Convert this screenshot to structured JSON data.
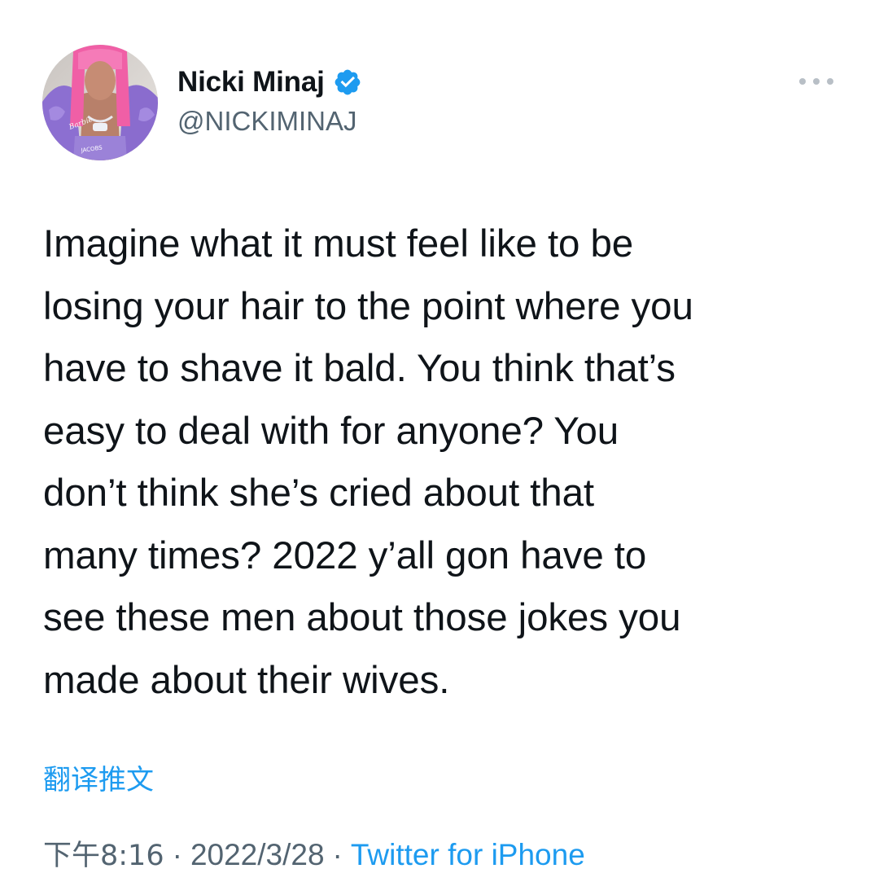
{
  "author": {
    "display_name": "Nicki Minaj",
    "handle": "@NICKIMINAJ",
    "verified": true,
    "avatar_icon": "profile-photo",
    "verified_icon": "verified-badge-icon"
  },
  "menu_icon": "more-dots-icon",
  "tweet": {
    "lines": [
      "Imagine what it must feel like to be",
      "losing your hair to the point where you",
      "have to shave it bald. You think that’s",
      "easy to deal with for anyone? You",
      "don’t think she’s cried about that",
      "many times? 2022 y’all gon have to",
      "see these men about those jokes you",
      "made about their wives."
    ]
  },
  "translate_label": "翻译推文",
  "meta": {
    "time": "下午8:16",
    "separator": "·",
    "date": "2022/3/28",
    "source": "Twitter for iPhone"
  },
  "colors": {
    "text_primary": "#0f1419",
    "text_secondary": "#536471",
    "accent": "#1d9bf0"
  }
}
